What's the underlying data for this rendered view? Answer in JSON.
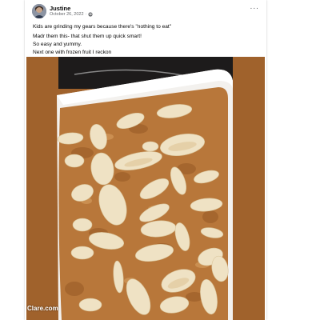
{
  "post": {
    "author": "Justine",
    "date": "October 26, 2022",
    "separator": "·",
    "privacy_icon": "globe-icon",
    "more_icon": "more-options-icon",
    "more_label": "···",
    "text_lines": [
      "Kids are grinding my gears because there's \"nothing to eat\"",
      "Madr them this- that shut them up quick smart!",
      "So easy and yummy.",
      "Next one with frozen fruit I reckon"
    ],
    "photo": {
      "description_icon": "apple-cake-photo",
      "watermark": "Clare.com"
    }
  },
  "colors": {
    "photo_border": "#a0622c",
    "cake": "#b8773a",
    "dish": "#f4f2ef",
    "secondary_text": "#65676b"
  }
}
